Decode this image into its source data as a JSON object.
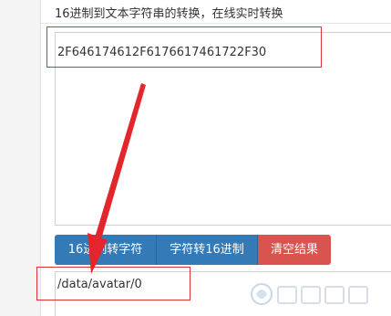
{
  "converter": {
    "title": "16进制到文本字符串的转换，在线实时转换",
    "input_value": "2F646174612F6176617461722F30",
    "output_value": "/data/avatar/0"
  },
  "buttons": {
    "hex_to_string": "16进制转字符",
    "string_to_hex": "字符转16进制",
    "clear": "清空结果"
  },
  "colors": {
    "primary": "#337ab7",
    "danger": "#d9534f",
    "annotation": "#d8343a"
  },
  "icons": {
    "watermark": "system-logo-watermark",
    "annotation": "red-arrow"
  }
}
